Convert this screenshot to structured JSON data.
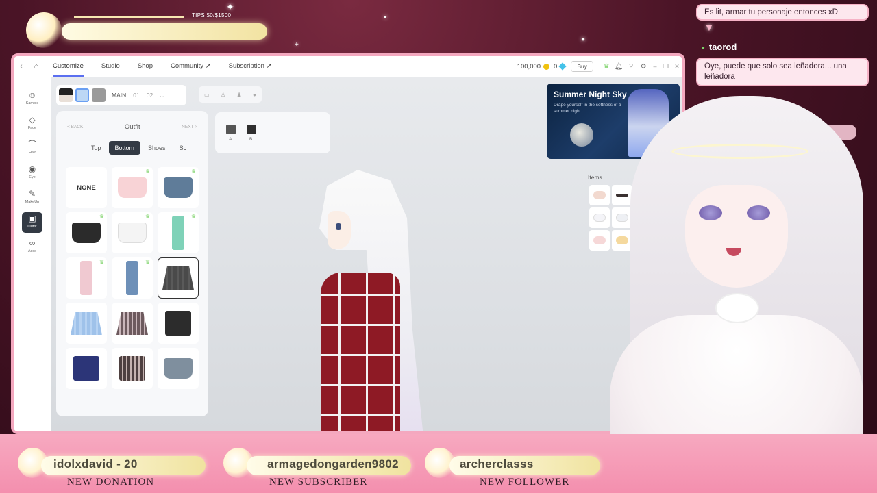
{
  "tips": {
    "label": "TIPS $0/$1500"
  },
  "app": {
    "nav": {
      "back_icon": "chevron-left-icon",
      "home_icon": "home-icon"
    },
    "tabs": [
      {
        "label": "Customize",
        "active": true
      },
      {
        "label": "Studio"
      },
      {
        "label": "Shop"
      },
      {
        "label": "Community ↗"
      },
      {
        "label": "Subscription ↗"
      }
    ],
    "currency": {
      "coins": "100,000",
      "gems": "0",
      "buy_label": "Buy"
    },
    "rail": [
      {
        "label": "Sample",
        "icon": "person-icon"
      },
      {
        "label": "Face",
        "icon": "face-icon"
      },
      {
        "label": "Hair",
        "icon": "hair-icon"
      },
      {
        "label": "Eye",
        "icon": "eye-icon"
      },
      {
        "label": "MakeUp",
        "icon": "makeup-icon"
      },
      {
        "label": "Outfit",
        "icon": "outfit-icon",
        "active": true
      },
      {
        "label": "Acce",
        "icon": "accessory-icon"
      }
    ],
    "presets": {
      "main_label": "MAIN",
      "slot1": "01",
      "slot2": "02",
      "more": "..."
    },
    "outfit_panel": {
      "back_label": "< BACK",
      "title": "Outfit",
      "next_label": "NEXT >",
      "subtabs": [
        "Top",
        "Bottom",
        "Shoes",
        "Sc"
      ],
      "active_subtab": "Bottom",
      "none_label": "NONE"
    },
    "color_options": {
      "a_label": "A",
      "b_label": "B",
      "a_color": "#555555",
      "b_color": "#2f2f2f"
    },
    "banner": {
      "title": "Summer Night Sky",
      "subtitle": "Drape yourself in the softness of a summer night"
    },
    "items_label": "Items"
  },
  "chat": {
    "messages": [
      {
        "text": "Es lit, armar tu personaje entonces xD"
      },
      {
        "user": "taorod",
        "text": "Oye, puede que solo sea leñadora... una leñadora"
      }
    ]
  },
  "alerts": [
    {
      "name": "idolxdavid - 20",
      "kind": "NEW DONATION"
    },
    {
      "name": "armagedongarden9802",
      "kind": "NEW SUBSCRIBER"
    },
    {
      "name": "archerclasss",
      "kind": "NEW FOLLOWER"
    }
  ]
}
